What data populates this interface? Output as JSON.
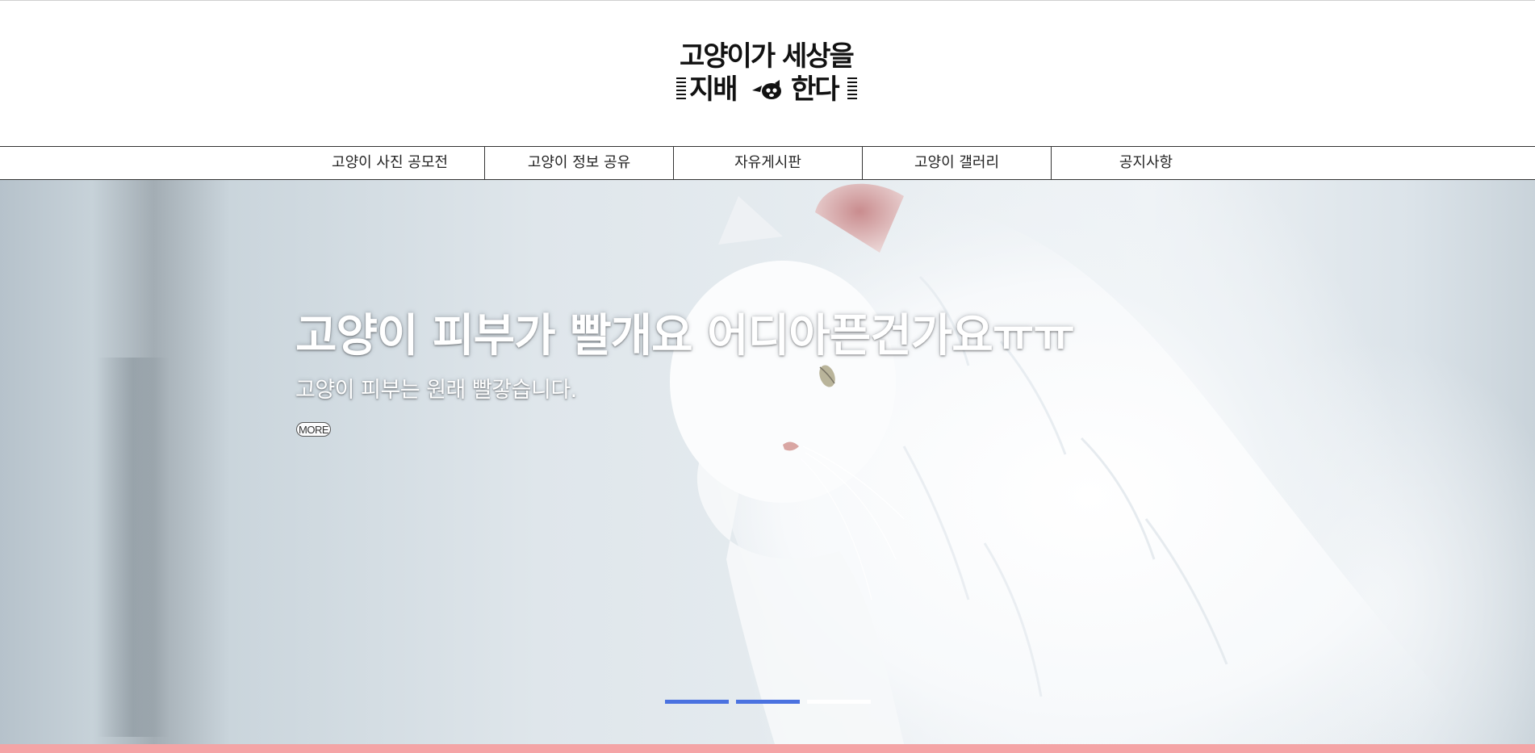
{
  "site": {
    "logo_line1": "고양이가 세상을",
    "logo_line2_left": "지배",
    "logo_line2_right": "한다"
  },
  "nav": {
    "items": [
      {
        "label": "고양이 사진 공모전"
      },
      {
        "label": "고양이 정보 공유"
      },
      {
        "label": "자유게시판"
      },
      {
        "label": "고양이 갤러리"
      },
      {
        "label": "공지사항"
      }
    ]
  },
  "hero": {
    "title": "고양이 피부가 빨개요 어디아픈건가요ㅠㅠ",
    "subtitle": "고양이 피부는 원래 빨갛습니다.",
    "more_label": "MORE",
    "slides": [
      {
        "active": true,
        "color": "#4a72e0"
      },
      {
        "active": true,
        "color": "#4a72e0"
      },
      {
        "active": false,
        "color": "#ffffff"
      }
    ]
  },
  "colors": {
    "accent_blue": "#4a72e0",
    "footer_strip": "#f4a4a6"
  }
}
